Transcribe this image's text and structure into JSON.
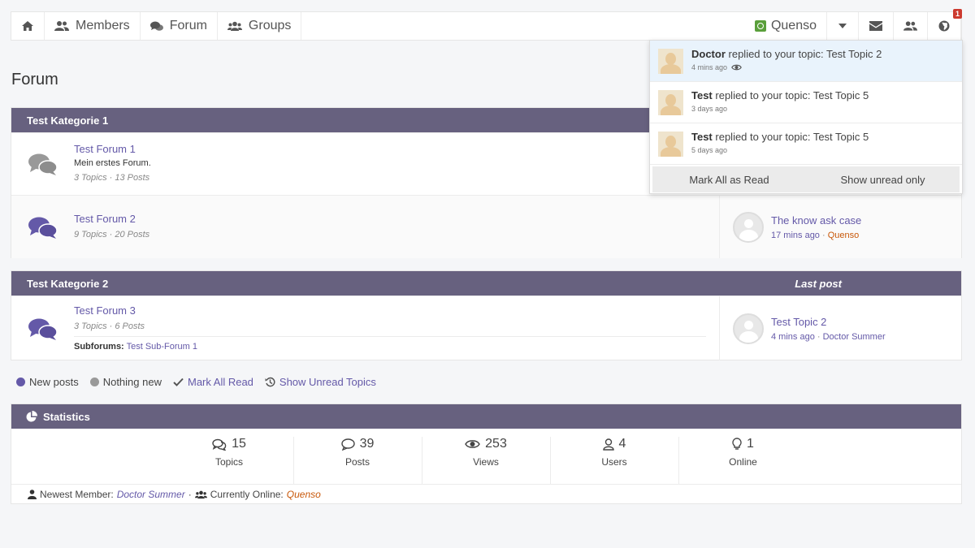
{
  "nav": {
    "members": "Members",
    "forum": "Forum",
    "groups": "Groups",
    "user": "Quenso",
    "notif_count": "1"
  },
  "page": {
    "title": "Forum"
  },
  "categories": [
    {
      "name": "Test Kategorie 1",
      "last_post_header": "",
      "forums": [
        {
          "title": "Test Forum 1",
          "desc": "Mein erstes Forum.",
          "stats": "3 Topics · 13 Posts"
        },
        {
          "title": "Test Forum 2",
          "stats": "9 Topics · 20 Posts",
          "last": {
            "title": "The know ask case",
            "time": "17 mins ago",
            "sep": "·",
            "user": "Quenso"
          }
        }
      ]
    },
    {
      "name": "Test Kategorie 2",
      "last_post_header": "Last post",
      "forums": [
        {
          "title": "Test Forum 3",
          "stats": "3 Topics · 6 Posts",
          "subforums_label": "Subforums:",
          "subforum": "Test Sub-Forum 1",
          "last": {
            "title": "Test Topic 2",
            "time": "4 mins ago",
            "sep": "·",
            "user": "Doctor Summer"
          }
        }
      ]
    }
  ],
  "legend": {
    "new_posts": "New posts",
    "nothing_new": "Nothing new",
    "mark_all": "Mark All Read",
    "show_unread": "Show Unread Topics",
    "new_color": "#6459a8",
    "nothing_color": "#999999"
  },
  "stats": {
    "title": "Statistics",
    "items": [
      {
        "value": "15",
        "label": "Topics",
        "icon": "comments-icon"
      },
      {
        "value": "39",
        "label": "Posts",
        "icon": "comment-icon"
      },
      {
        "value": "253",
        "label": "Views",
        "icon": "eye-icon"
      },
      {
        "value": "4",
        "label": "Users",
        "icon": "user-icon"
      },
      {
        "value": "1",
        "label": "Online",
        "icon": "lightbulb-icon"
      }
    ],
    "newest_label": "Newest Member:",
    "newest": "Doctor Summer",
    "sep": "·",
    "online_label": "Currently Online:",
    "online": "Quenso"
  },
  "notifications": {
    "items": [
      {
        "user": "Doctor",
        "text": "replied to your topic: Test Topic 2",
        "time": "4 mins ago"
      },
      {
        "user": "Test",
        "text": "replied to your topic: Test Topic 5",
        "time": "3 days ago"
      },
      {
        "user": "Test",
        "text": "replied to your topic: Test Topic 5",
        "time": "5 days ago"
      }
    ],
    "mark_all": "Mark All as Read",
    "show_unread": "Show unread only"
  },
  "colors": {
    "header": "#67617f",
    "accent": "#6459a8",
    "orange": "#c8580a",
    "badge": "#cc3a2f"
  }
}
